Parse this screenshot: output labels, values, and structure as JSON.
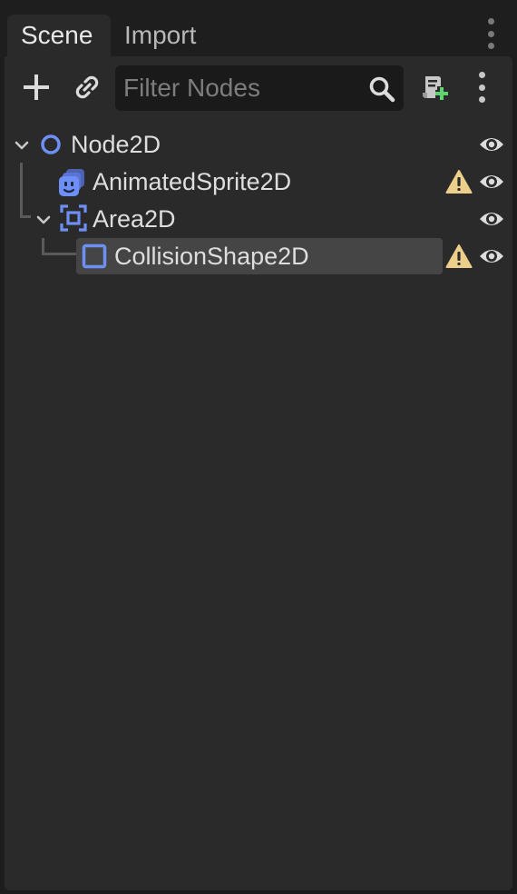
{
  "tabs": [
    {
      "label": "Scene",
      "active": true
    },
    {
      "label": "Import",
      "active": false
    }
  ],
  "toolbar": {
    "add_icon": "plus-icon",
    "link_icon": "link-icon",
    "filter_placeholder": "Filter Nodes",
    "filter_value": "",
    "search_icon": "search-icon",
    "script_icon": "attach-script-icon",
    "menu_icon": "kebab-menu-icon"
  },
  "tree": {
    "nodes": [
      {
        "name": "Node2D",
        "icon": "node2d-circle-icon",
        "expanded": true,
        "warning": false,
        "visible": true,
        "selected": false
      },
      {
        "name": "AnimatedSprite2D",
        "icon": "animated-sprite-icon",
        "warning": true,
        "visible": true,
        "selected": false
      },
      {
        "name": "Area2D",
        "icon": "area2d-icon",
        "expanded": true,
        "warning": false,
        "visible": true,
        "selected": false
      },
      {
        "name": "CollisionShape2D",
        "icon": "collision-shape-icon",
        "warning": true,
        "visible": true,
        "selected": true
      }
    ]
  },
  "colors": {
    "accent_blue": "#6e8ff5",
    "warning_yellow": "#eccf8b",
    "selection": "#454545",
    "panel": "#2a2a2a",
    "background": "#1d1d1d"
  }
}
